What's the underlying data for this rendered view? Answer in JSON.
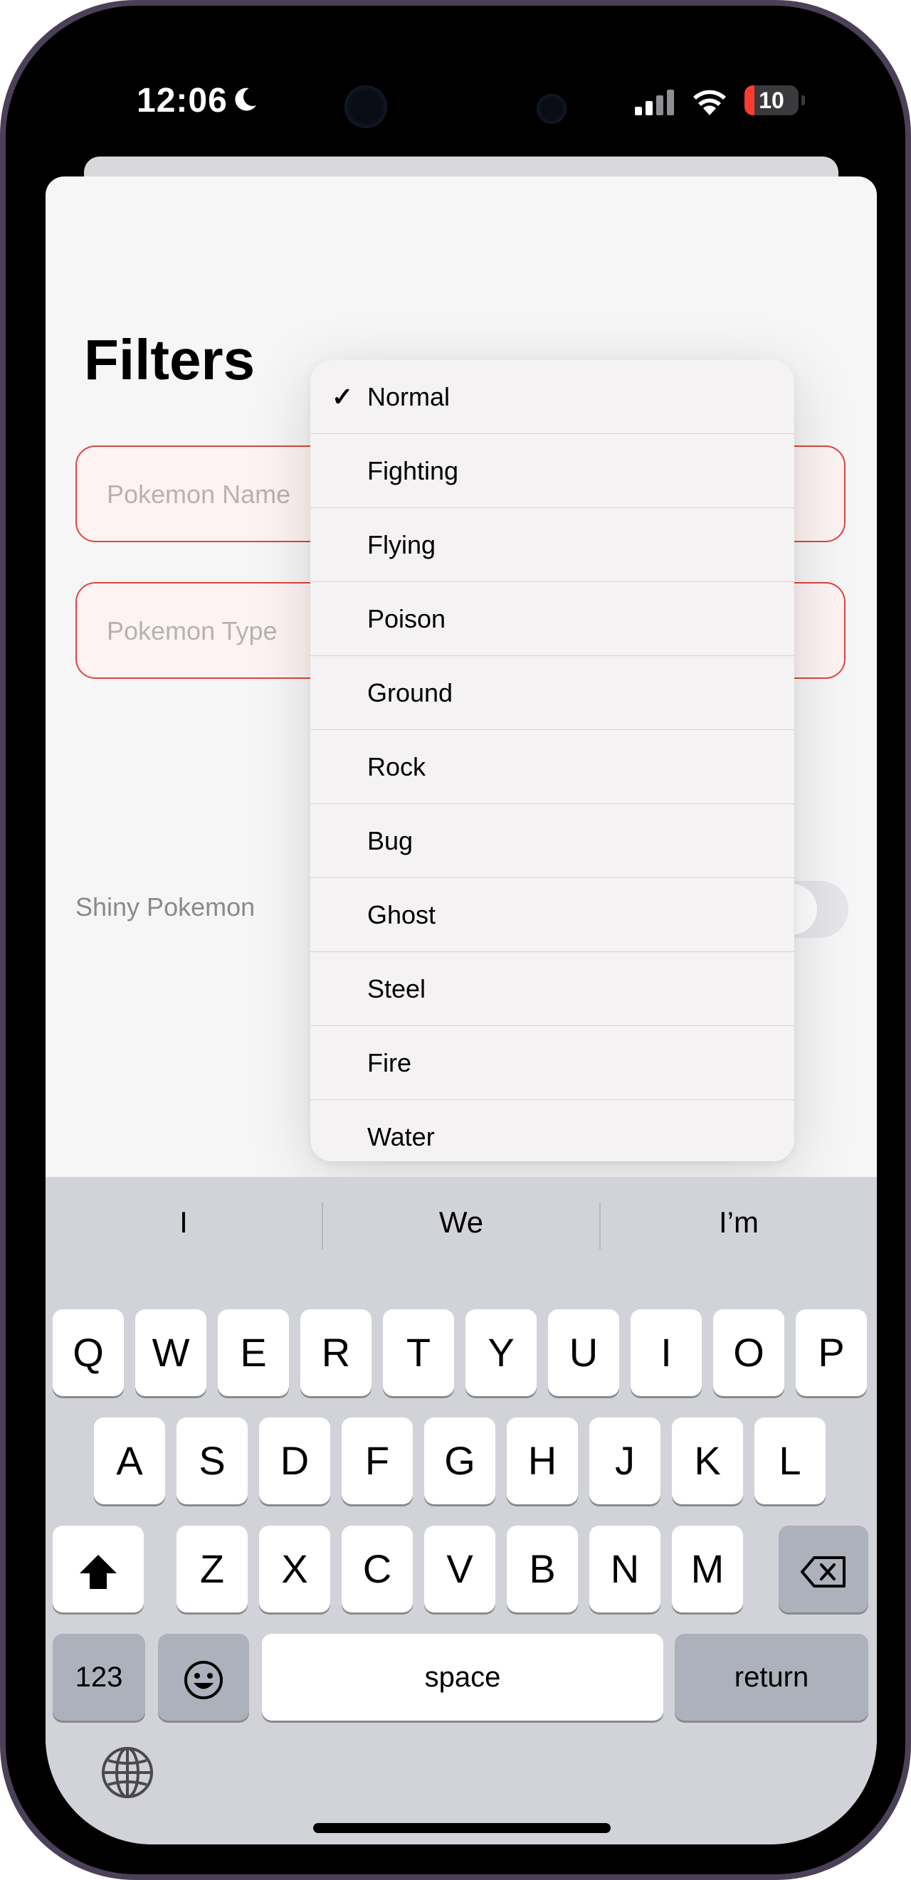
{
  "status_bar": {
    "time": "12:06",
    "battery_level": "10",
    "icons": [
      "moon-icon",
      "cellular-signal-icon",
      "wifi-icon",
      "battery-icon"
    ]
  },
  "filters": {
    "title": "Filters",
    "name_field": {
      "placeholder": "Pokemon Name",
      "value": ""
    },
    "type_field": {
      "placeholder": "Pokemon Type",
      "value": ""
    },
    "shiny_label": "Shiny Pokemon",
    "shiny_on": false
  },
  "type_menu": {
    "selected": "Normal",
    "items": [
      "Normal",
      "Fighting",
      "Flying",
      "Poison",
      "Ground",
      "Rock",
      "Bug",
      "Ghost",
      "Steel",
      "Fire",
      "Water"
    ]
  },
  "keyboard": {
    "suggestions": [
      "I",
      "We",
      "I’m"
    ],
    "row1": [
      "Q",
      "W",
      "E",
      "R",
      "T",
      "Y",
      "U",
      "I",
      "O",
      "P"
    ],
    "row2": [
      "A",
      "S",
      "D",
      "F",
      "G",
      "H",
      "J",
      "K",
      "L"
    ],
    "row3": [
      "Z",
      "X",
      "C",
      "V",
      "B",
      "N",
      "M"
    ],
    "numbers_label": "123",
    "space_label": "space",
    "return_label": "return"
  },
  "colors": {
    "field_border": "#e0443e",
    "field_bg": "#fdf3f3",
    "device_frame": "#4a4058",
    "keyboard_bg": "#d1d3d9"
  }
}
